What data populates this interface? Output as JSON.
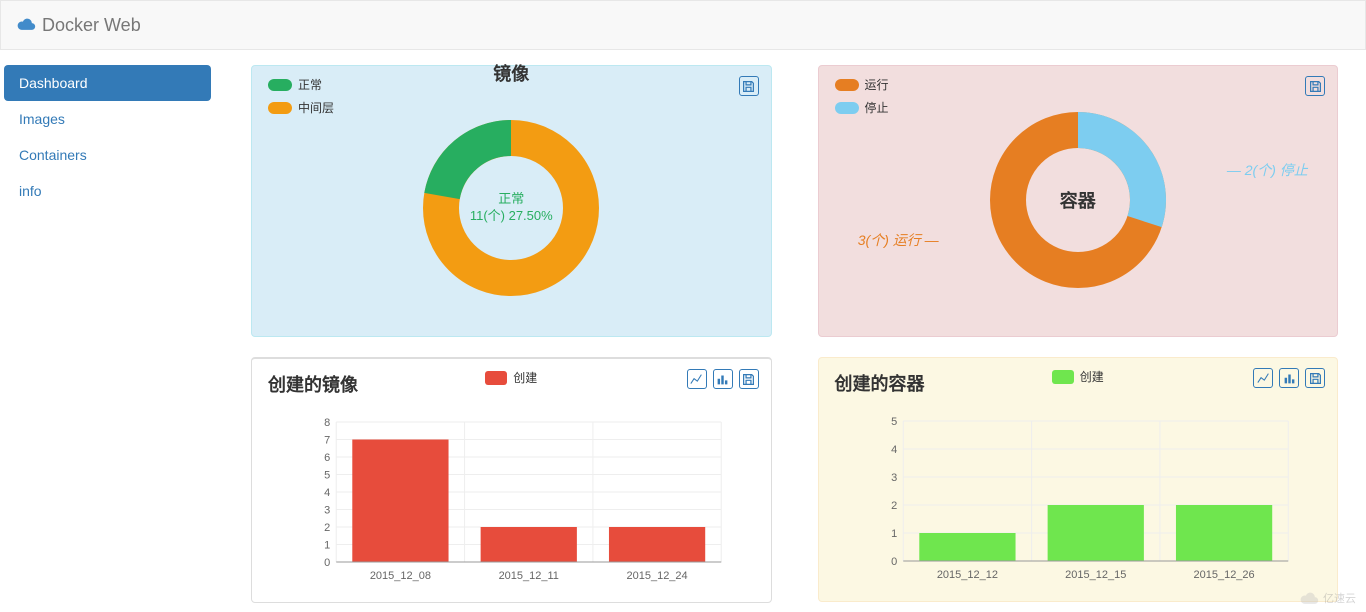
{
  "navbar": {
    "brand": "Docker Web"
  },
  "sidebar": {
    "items": [
      {
        "label": "Dashboard",
        "active": true
      },
      {
        "label": "Images",
        "active": false
      },
      {
        "label": "Containers",
        "active": false
      },
      {
        "label": "info",
        "active": false
      }
    ]
  },
  "colors": {
    "green": "#27ae60",
    "orange": "#f39c12",
    "orangeRed": "#e67e22",
    "skyBlue": "#7dcdf0",
    "red": "#e74c3c",
    "lime": "#6fe64e",
    "link": "#337ab7"
  },
  "panels": {
    "images_donut": {
      "title": "镜像",
      "legend": [
        {
          "label": "正常",
          "color": "#27ae60"
        },
        {
          "label": "中间层",
          "color": "#f39c12"
        }
      ],
      "center_line1": "正常",
      "center_line2": "11(个) 27.50%",
      "center_color": "#27ae60"
    },
    "containers_donut": {
      "title": "容器",
      "legend": [
        {
          "label": "运行",
          "color": "#e67e22"
        },
        {
          "label": "停止",
          "color": "#7dcdf0"
        }
      ],
      "center_color": "#333",
      "label_left": "3(个) 运行",
      "label_right": "2(个) 停止",
      "label_left_color": "#e67e22",
      "label_right_color": "#7dcdf0"
    },
    "images_bar": {
      "title": "创建的镜像",
      "legend_label": "创建",
      "legend_color": "#e74c3c"
    },
    "containers_bar": {
      "title": "创建的容器",
      "legend_label": "创建",
      "legend_color": "#6fe64e"
    }
  },
  "chart_data": [
    {
      "id": "images_donut",
      "type": "pie",
      "title": "镜像",
      "series": [
        {
          "name": "正常",
          "value": 11,
          "percent": 27.5,
          "color": "#27ae60"
        },
        {
          "name": "中间层",
          "value": 29,
          "percent": 72.5,
          "color": "#f39c12"
        }
      ]
    },
    {
      "id": "containers_donut",
      "type": "pie",
      "title": "容器",
      "series": [
        {
          "name": "运行",
          "value": 3,
          "percent": 60,
          "color": "#e67e22"
        },
        {
          "name": "停止",
          "value": 2,
          "percent": 40,
          "color": "#7dcdf0"
        }
      ]
    },
    {
      "id": "images_bar",
      "type": "bar",
      "title": "创建的镜像",
      "xlabel": "",
      "ylabel": "",
      "ylim": [
        0,
        8
      ],
      "categories": [
        "2015_12_08",
        "2015_12_11",
        "2015_12_24"
      ],
      "series": [
        {
          "name": "创建",
          "values": [
            7,
            2,
            2
          ],
          "color": "#e74c3c"
        }
      ]
    },
    {
      "id": "containers_bar",
      "type": "bar",
      "title": "创建的容器",
      "xlabel": "",
      "ylabel": "",
      "ylim": [
        0,
        5
      ],
      "categories": [
        "2015_12_12",
        "2015_12_15",
        "2015_12_26"
      ],
      "series": [
        {
          "name": "创建",
          "values": [
            1,
            2,
            2
          ],
          "color": "#6fe64e"
        }
      ]
    }
  ],
  "watermark": "亿速云"
}
